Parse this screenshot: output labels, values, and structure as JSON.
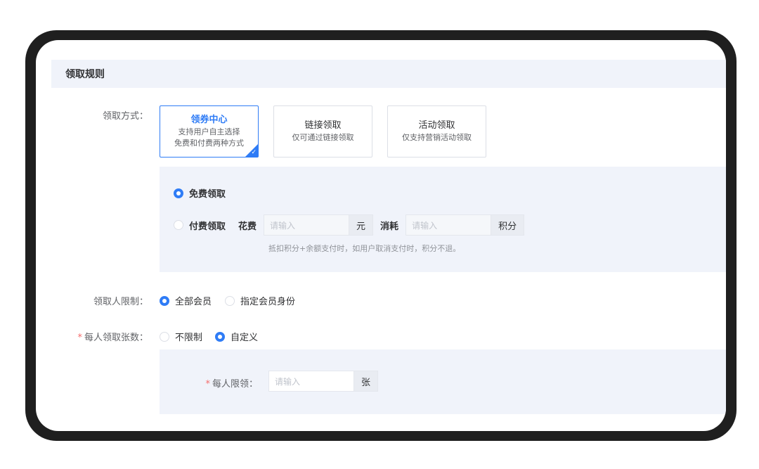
{
  "section": {
    "title": "领取规则"
  },
  "claim_method": {
    "label": "领取方式：",
    "options": [
      {
        "title": "领券中心",
        "desc_line1": "支持用户自主选择",
        "desc_line2": "免费和付费两种方式",
        "selected": true
      },
      {
        "title": "链接领取",
        "desc_line1": "仅可通过链接领取",
        "selected": false
      },
      {
        "title": "活动领取",
        "desc_line1": "仅支持营销活动领取",
        "selected": false
      }
    ],
    "free_label": "免费领取",
    "paid_label": "付费领取",
    "cost_label": "花费",
    "cost_placeholder": "请输入",
    "cost_unit": "元",
    "consume_label": "消耗",
    "consume_placeholder": "请输入",
    "consume_unit": "积分",
    "hint": "抵扣积分+余额支付时，如用户取消支付时，积分不退。"
  },
  "claimer_limit": {
    "label": "领取人限制：",
    "options": [
      "全部会员",
      "指定会员身份"
    ],
    "selected": "全部会员"
  },
  "per_person": {
    "required_mark": "*",
    "label": "每人领取张数：",
    "options": [
      "不限制",
      "自定义"
    ],
    "selected": "自定义",
    "limit_label": "每人限领：",
    "limit_placeholder": "请输入",
    "limit_unit": "张"
  },
  "colors": {
    "accent": "#2f7cf6",
    "panel_bg": "#f0f3fa",
    "required": "#f56c6c",
    "frame": "#1f1f1f"
  }
}
